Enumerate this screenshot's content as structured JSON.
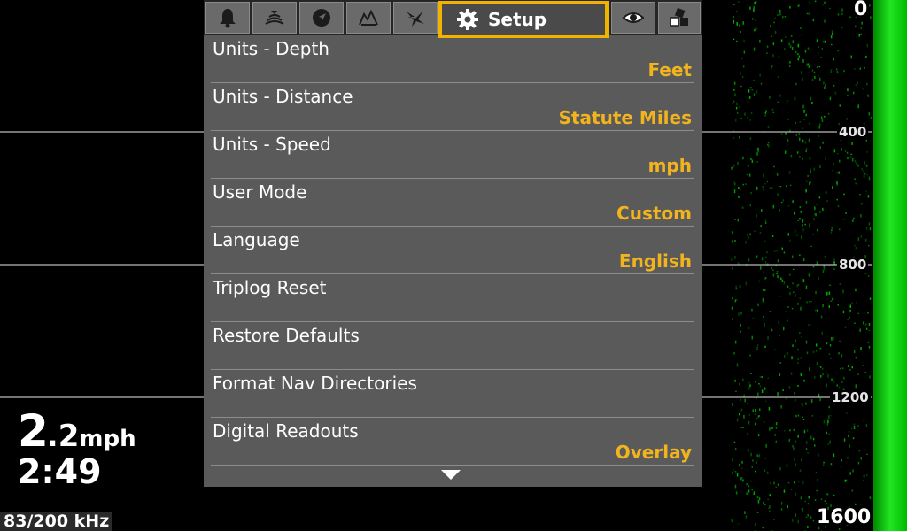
{
  "sonar": {
    "depth_scale": [
      "0",
      "400",
      "800",
      "1200",
      "1600"
    ],
    "accent": "#00e000"
  },
  "readouts": {
    "speed_int": "2",
    "speed_dec": ".2",
    "speed_unit": "mph",
    "time": "2:49",
    "frequency": "83/200 kHz"
  },
  "menu": {
    "tabs": [
      {
        "icon": "alarm-bell-icon"
      },
      {
        "icon": "sonar-fish-icon"
      },
      {
        "icon": "navigation-icon"
      },
      {
        "icon": "chart-map-icon"
      },
      {
        "icon": "humminbird-icon"
      },
      {
        "icon": "gear-icon",
        "label": "Setup",
        "active": true
      },
      {
        "icon": "eye-icon"
      },
      {
        "icon": "accessories-icon"
      }
    ],
    "items": [
      {
        "title": "Units - Depth",
        "value": "Feet"
      },
      {
        "title": "Units - Distance",
        "value": "Statute Miles"
      },
      {
        "title": "Units - Speed",
        "value": "mph"
      },
      {
        "title": "User Mode",
        "value": "Custom"
      },
      {
        "title": "Language",
        "value": "English"
      },
      {
        "title": "Triplog Reset",
        "value": ""
      },
      {
        "title": "Restore Defaults",
        "value": ""
      },
      {
        "title": "Format Nav Directories",
        "value": ""
      },
      {
        "title": "Digital Readouts",
        "value": "Overlay"
      }
    ],
    "highlight_color": "#f0b400",
    "value_color": "#f2b41e"
  }
}
